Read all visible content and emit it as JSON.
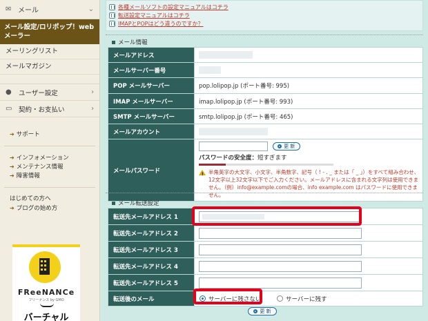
{
  "sidebar": {
    "header": "メール",
    "active_item": "メール設定/ロリポップ！webメーラー",
    "links": [
      "メーリングリスト",
      "メールマガジン"
    ],
    "categories": [
      "ユーザー設定",
      "契約・お支払い"
    ],
    "support": [
      "サポート"
    ],
    "info_links": [
      "インフォメーション",
      "メンテナンス情報",
      "障害情報"
    ],
    "beginner_title": "はじめての方へ",
    "beginner_links": [
      "ブログの始め方"
    ],
    "banner": {
      "logo": "FReeNANCe",
      "sub": "フリーナンス by GMO",
      "text": "バーチャル"
    }
  },
  "help_links": [
    "各種メールソフトの設定マニュアルはコチラ",
    "転送設定マニュアルはコチラ",
    "IMAPとPOPはどう違うのですか？"
  ],
  "mail_info": {
    "title": "メール情報",
    "rows": [
      {
        "label": "メールアドレス",
        "value": ""
      },
      {
        "label": "メールサーバー番号",
        "value": ""
      },
      {
        "label": "POP メールサーバー",
        "value": "pop.lolipop.jp (ポート番号: 995)"
      },
      {
        "label": "IMAP メールサーバー",
        "value": "imap.lolipop.jp (ポート番号: 993)"
      },
      {
        "label": "SMTP メールサーバー",
        "value": "smtp.lolipop.jp (ポート番号: 465)"
      },
      {
        "label": "メールアカウント",
        "value": ""
      }
    ],
    "password_label": "メールパスワード",
    "update_button": "更 新",
    "strength_label": "パスワードの安全度：",
    "strength_value": "短すぎます",
    "strength_fraction": 0.2,
    "warning": "半角英字の大文字、小文字、半角数字、記号（ ! - . _ または「 _ 」）をすべて組み合わせ、12文字以上32文字以下でご入力ください。メールアドレスに含まれる文字列は使用できません。（例）info@example.comの場合、info example.com はパスワードに使用できません。"
  },
  "forward": {
    "title": "メール転送設定",
    "rows": [
      "転送先メールアドレス 1",
      "転送先メールアドレス 2",
      "転送先メールアドレス 3",
      "転送先メールアドレス 4",
      "転送先メールアドレス 5"
    ],
    "after_label": "転送後のメール",
    "option_keep_not": "サーバーに残さない",
    "option_keep": "サーバーに残す",
    "selected": "サーバーに残さない",
    "update_button": "更 新"
  },
  "colors": {
    "header_bg": "#2f5f5b",
    "highlight": "#e5001c",
    "active_sidebar": "#6b5317"
  }
}
